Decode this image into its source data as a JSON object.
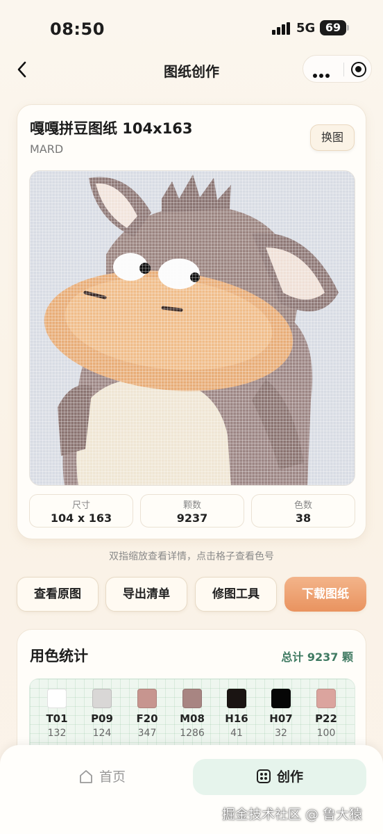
{
  "status_bar": {
    "time": "08:50",
    "network": "5G",
    "battery": "69"
  },
  "nav": {
    "title": "图纸创作"
  },
  "pattern_card": {
    "title": "嘎嘎拼豆图纸 104x163",
    "subtitle": "MARD",
    "swap_label": "换图",
    "stats": [
      {
        "label": "尺寸",
        "value": "104 x 163"
      },
      {
        "label": "颗数",
        "value": "9237"
      },
      {
        "label": "色数",
        "value": "38"
      }
    ]
  },
  "hint": "双指缩放查看详情，点击格子查看色号",
  "actions": [
    "查看原图",
    "导出清单",
    "修图工具",
    "下载图纸"
  ],
  "color_stats": {
    "title": "用色统计",
    "total": "总计 9237 颗",
    "colors": [
      {
        "code": "T01",
        "count": "132",
        "color": "#ffffff"
      },
      {
        "code": "P09",
        "count": "124",
        "color": "#d9d7d6"
      },
      {
        "code": "F20",
        "count": "347",
        "color": "#c7958f"
      },
      {
        "code": "M08",
        "count": "1286",
        "color": "#a88582"
      },
      {
        "code": "H16",
        "count": "41",
        "color": "#1a1412"
      },
      {
        "code": "H07",
        "count": "32",
        "color": "#060606"
      },
      {
        "code": "P22",
        "count": "100",
        "color": "#dba49e"
      }
    ]
  },
  "tabs": {
    "home": "首页",
    "create": "创作"
  },
  "watermark": "掘金技术社区 @ 鲁大猿"
}
